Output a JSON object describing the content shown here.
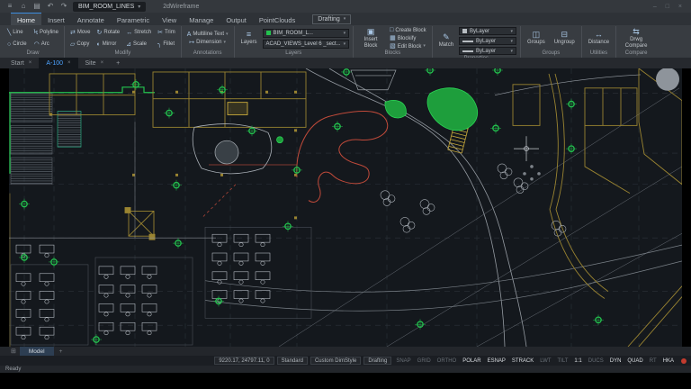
{
  "colors": {
    "accent_blue": "#3c8de0",
    "canvas_bg": "#14181d",
    "line_yellow": "#9a8431",
    "line_yellow_bright": "#c8aa3c",
    "marker_green": "#23c24e",
    "fill_green": "#1e9e3c",
    "line_red": "#c04a3a",
    "line_white": "#c9ced4",
    "line_gray": "#5c636b",
    "line_teal": "#2bbf8e"
  },
  "titlebar": {
    "file_tab": "BIM_ROOM_LINES",
    "view_style": "2dWireframe",
    "workspace": "Drafting"
  },
  "ribbon": {
    "tabs": [
      {
        "label": "Home",
        "active": true
      },
      {
        "label": "Insert"
      },
      {
        "label": "Annotate"
      },
      {
        "label": "Parametric"
      },
      {
        "label": "View"
      },
      {
        "label": "Manage"
      },
      {
        "label": "Output"
      },
      {
        "label": "PointClouds"
      }
    ],
    "panels": {
      "draw": {
        "label": "Draw",
        "tools": [
          "Line",
          "Polyline",
          "Circle",
          "Arc"
        ]
      },
      "modify": {
        "label": "Modify",
        "tools": [
          "Move",
          "Rotate",
          "Stretch",
          "Trim",
          "Copy",
          "Mirror",
          "Scale",
          "Fillet"
        ]
      },
      "annotations": {
        "label": "Annotations",
        "tools": [
          "Multiline Text",
          "Dimension"
        ]
      },
      "layers": {
        "label": "Layers",
        "tool": "Layers",
        "current_layer": "BIM_ROOM_L...",
        "layer_state": "ACAD_VIEWS_Level 6 _sect..."
      },
      "blocks": {
        "label": "Blocks",
        "main_tool": "Insert Block",
        "tools": [
          "Create Block",
          "Blockify",
          "Edit Block"
        ]
      },
      "properties": {
        "label": "Properties",
        "match_tool": "Match",
        "rows": [
          "ByLayer",
          "ByLayer",
          "ByLayer"
        ]
      },
      "groups": {
        "label": "Groups",
        "tools": [
          "Groups",
          "Ungroup"
        ]
      },
      "utilities": {
        "label": "Utilities",
        "tools": [
          "Distance"
        ]
      },
      "compare": {
        "label": "Compare",
        "tools": [
          "Drwg Compare"
        ]
      }
    }
  },
  "doc_tabs": {
    "tabs": [
      {
        "label": "Start"
      },
      {
        "label": "A-100",
        "active": true
      },
      {
        "label": "Site"
      }
    ]
  },
  "model_bar": {
    "tabs": [
      {
        "label": "Model",
        "active": true
      }
    ]
  },
  "status_bar": {
    "coordinates": "9220.17, 24797.11, 0",
    "text_style": "Standard",
    "dim_style": "Custom DimStyle",
    "workspace": "Drafting",
    "toggles": [
      {
        "label": "SNAP",
        "on": false
      },
      {
        "label": "GRID",
        "on": false
      },
      {
        "label": "ORTHO",
        "on": false
      },
      {
        "label": "POLAR",
        "on": true
      },
      {
        "label": "ESNAP",
        "on": true
      },
      {
        "label": "STRACK",
        "on": true
      },
      {
        "label": "LWT",
        "on": false
      },
      {
        "label": "TILT",
        "on": false
      },
      {
        "label": "1:1",
        "on": true
      },
      {
        "label": "DUCS",
        "on": false
      },
      {
        "label": "DYN",
        "on": true
      },
      {
        "label": "QUAD",
        "on": true
      },
      {
        "label": "RT",
        "on": false
      },
      {
        "label": "HKA",
        "on": true
      }
    ]
  },
  "footer": {
    "status": "Ready"
  },
  "icons": {
    "menu": "≡",
    "home": "⌂",
    "undo": "↶",
    "redo": "↷",
    "doc": "▤",
    "dropdown": "▾",
    "close": "×",
    "plus": "+",
    "line": "╲",
    "polyline": "Ϟ",
    "circle": "○",
    "arc": "◠",
    "move": "⇄",
    "rotate": "↻",
    "stretch": "↔",
    "trim": "✂",
    "copy": "▱",
    "mirror": "◐",
    "scale": "⊿",
    "fillet": "╮",
    "mtext": "A",
    "dimension": "↦",
    "layers": "≡",
    "insert_block": "▣",
    "create_block": "□",
    "blockify": "▦",
    "edit_block": "▧",
    "match": "✎",
    "groups": "◫",
    "ungroup": "⊟",
    "distance": "↔",
    "compare": "⇆",
    "model": "⊞"
  }
}
